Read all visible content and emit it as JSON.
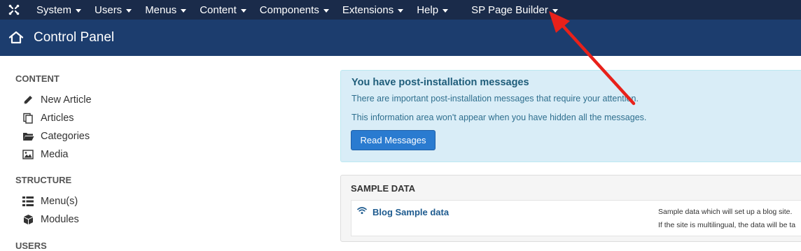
{
  "topnav": {
    "logo_icon": "joomla-logo-icon",
    "items": [
      {
        "label": "System"
      },
      {
        "label": "Users"
      },
      {
        "label": "Menus"
      },
      {
        "label": "Content"
      },
      {
        "label": "Components"
      },
      {
        "label": "Extensions"
      },
      {
        "label": "Help"
      },
      {
        "label": "SP Page Builder"
      }
    ]
  },
  "titlebar": {
    "icon": "home-icon",
    "title": "Control Panel"
  },
  "sidebar": {
    "content_heading": "CONTENT",
    "content_items": [
      {
        "label": "New Article",
        "icon": "pencil-icon"
      },
      {
        "label": "Articles",
        "icon": "copy-icon"
      },
      {
        "label": "Categories",
        "icon": "folder-icon"
      },
      {
        "label": "Media",
        "icon": "image-icon"
      }
    ],
    "structure_heading": "STRUCTURE",
    "structure_items": [
      {
        "label": "Menu(s)",
        "icon": "list-icon"
      },
      {
        "label": "Modules",
        "icon": "cube-icon"
      }
    ],
    "users_heading": "USERS"
  },
  "alert": {
    "title": "You have post-installation messages",
    "line1": "There are important post-installation messages that require your attention.",
    "line2": "This information area won't appear when you have hidden all the messages.",
    "button": "Read Messages"
  },
  "sample_data": {
    "heading": "SAMPLE DATA",
    "item_label": "Blog Sample data",
    "item_icon": "wifi-icon",
    "desc1": "Sample data which will set up a blog site.",
    "desc2": "If the site is multilingual, the data will be ta"
  },
  "colors": {
    "topnav_bg": "#1a2b4a",
    "titlebar_bg": "#1c3d6e",
    "alert_bg": "#d9edf7",
    "button_bg": "#2a7bd0",
    "annotation_arrow": "#e8211a"
  }
}
